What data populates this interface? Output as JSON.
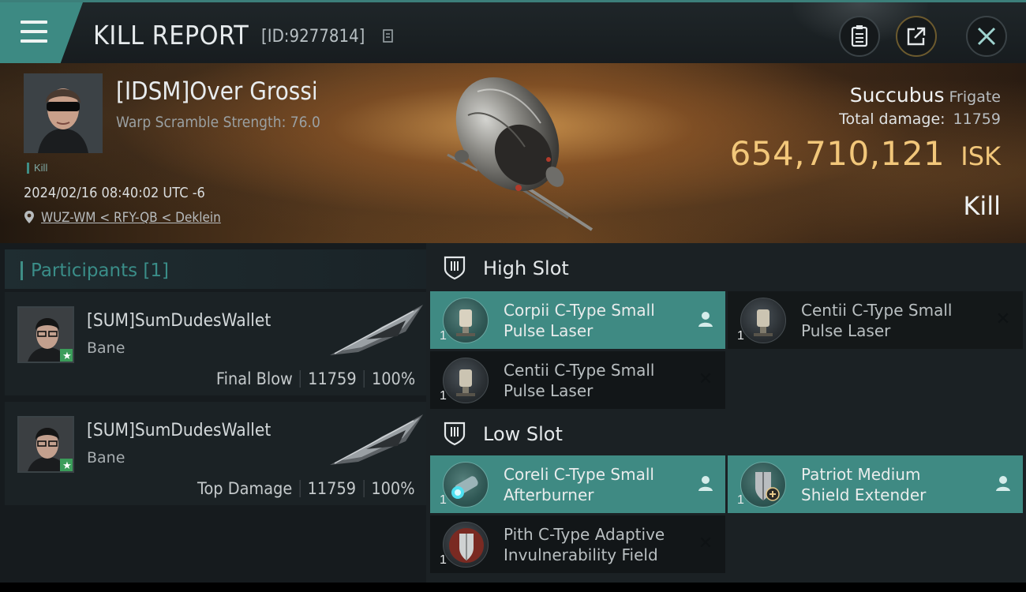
{
  "header": {
    "title": "KILL REPORT",
    "report_id": "[ID:9277814]"
  },
  "icons": {
    "menu": "hamburger-menu-icon",
    "copy": "copy-icon",
    "clipboard": "clipboard-icon",
    "share": "share-icon",
    "close": "close-icon",
    "location": "location-pin-icon",
    "slot": "slot-icon",
    "pilot": "pilot-icon",
    "destroyed": "x-icon"
  },
  "victim": {
    "name": "[IDSM]Over Grossi",
    "warp_scramble": "Warp Scramble Strength: 76.0",
    "tag": "Kill",
    "timestamp": "2024/02/16 08:40:02 UTC -6",
    "location": "WUZ-WM < RFY-QB < Deklein"
  },
  "ship": {
    "name": "Succubus",
    "class": "Frigate",
    "total_damage_label": "Total damage:",
    "total_damage": "11759",
    "isk_value": "654,710,121",
    "isk_unit": "ISK",
    "result": "Kill"
  },
  "participants": {
    "label": "Participants",
    "count": "[1]",
    "items": [
      {
        "name": "[SUM]SumDudesWallet",
        "ship": "Bane",
        "role": "Final Blow",
        "damage": "11759",
        "percent": "100%"
      },
      {
        "name": "[SUM]SumDudesWallet",
        "ship": "Bane",
        "role": "Top Damage",
        "damage": "11759",
        "percent": "100%"
      }
    ]
  },
  "slots": {
    "high": {
      "label": "High Slot",
      "modules": [
        {
          "line1": "Corpii C-Type Small",
          "line2": "Pulse Laser",
          "qty": "1",
          "status": "fitted"
        },
        {
          "line1": "Centii C-Type Small",
          "line2": "Pulse Laser",
          "qty": "1",
          "status": "destroyed"
        },
        {
          "line1": "Centii C-Type Small",
          "line2": "Pulse Laser",
          "qty": "1",
          "status": "destroyed"
        }
      ]
    },
    "low": {
      "label": "Low Slot",
      "modules": [
        {
          "line1": "Coreli C-Type Small",
          "line2": "Afterburner",
          "qty": "1",
          "status": "fitted"
        },
        {
          "line1": "Patriot Medium",
          "line2": "Shield Extender",
          "qty": "1",
          "status": "fitted"
        },
        {
          "line1": "Pith C-Type Adaptive",
          "line2": "Invulnerability Field",
          "qty": "1",
          "status": "destroyed"
        }
      ]
    }
  },
  "colors": {
    "accent": "#3f8a83",
    "isk": "#f2c77a",
    "panel": "#1b2124"
  }
}
